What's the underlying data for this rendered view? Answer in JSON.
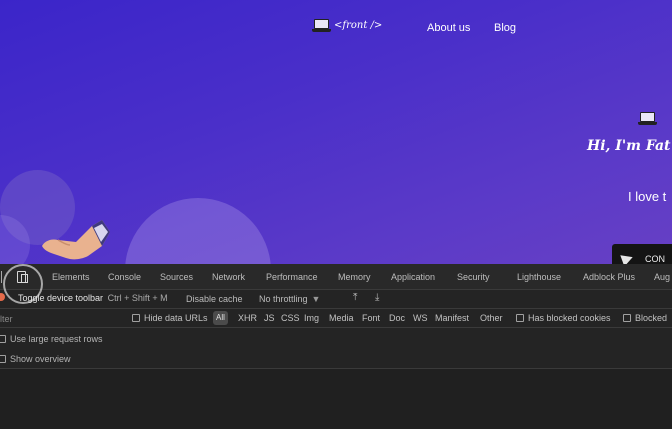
{
  "site": {
    "logo_text": "<front />",
    "nav": {
      "about": "About us",
      "blog": "Blog"
    },
    "hero": {
      "title": "Hi, I'm Fat",
      "subtitle": "I love t",
      "button_label": "CON"
    }
  },
  "devtools": {
    "tabs": [
      "Elements",
      "Console",
      "Sources",
      "Network",
      "Performance",
      "Memory",
      "Application",
      "Security",
      "Lighthouse",
      "Adblock Plus",
      "Aug"
    ],
    "tooltip": {
      "label": "Toggle device toolbar",
      "shortcut": "Ctrl + Shift + M"
    },
    "toolbar": {
      "disable_cache": "Disable cache",
      "throttling": "No throttling",
      "caret": "▼"
    },
    "filter": {
      "placeholder": "ilter",
      "hide_data_urls": "Hide data URLs",
      "all": "All",
      "types": [
        "XHR",
        "JS",
        "CSS",
        "Img",
        "Media",
        "Font",
        "Doc",
        "WS",
        "Manifest",
        "Other"
      ],
      "has_blocked_cookies": "Has blocked cookies",
      "blocked": "Blocked"
    },
    "options": {
      "large_rows": "Use large request rows",
      "overview": "Show overview"
    }
  },
  "colors": {
    "site_gradient_start": "#3b25c9",
    "site_gradient_end": "#6740c4",
    "devtools_bg": "#242424",
    "record_dot": "#e46a4a"
  }
}
